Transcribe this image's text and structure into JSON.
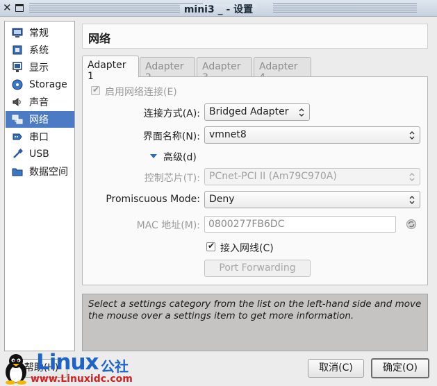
{
  "window": {
    "title": "mini3 _ - 设置"
  },
  "sidebar": {
    "items": [
      {
        "label": "常规"
      },
      {
        "label": "系统"
      },
      {
        "label": "显示"
      },
      {
        "label": "Storage"
      },
      {
        "label": "声音"
      },
      {
        "label": "网络"
      },
      {
        "label": "串口"
      },
      {
        "label": "USB"
      },
      {
        "label": "数据空间"
      }
    ],
    "active_index": 5
  },
  "page": {
    "title": "网络"
  },
  "tabs": [
    {
      "label": "Adapter 1"
    },
    {
      "label": "Adapter 2"
    },
    {
      "label": "Adapter 3"
    },
    {
      "label": "Adapter 4"
    }
  ],
  "form": {
    "enable_label": "启用网络连接(E)",
    "enable_checked": true,
    "attach_label": "连接方式(A):",
    "attach_value": "Bridged Adapter",
    "name_label": "界面名称(N):",
    "name_value": "vmnet8",
    "advanced_label": "高级(d)",
    "chip_label": "控制芯片(T):",
    "chip_value": "PCnet-PCI II (Am79C970A)",
    "promisc_label": "Promiscuous Mode:",
    "promisc_value": "Deny",
    "mac_label": "MAC 地址(M):",
    "mac_value": "0800277FB6DC",
    "cable_label": "接入网线(C)",
    "cable_checked": true,
    "port_forwarding_label": "Port Forwarding"
  },
  "info_text": "Select a settings category from the list on the left-hand side and move the mouse over a settings item to get more information.",
  "footer": {
    "help_label": "帮助(H)",
    "cancel_label": "取消(C)",
    "ok_label": "确定(O)"
  },
  "watermark": {
    "brand": "Linux",
    "suffix": "公社",
    "url": "www.Linuxidc.com"
  },
  "colors": {
    "selection": "#4b7bc4",
    "watermark_blue": "#1e64c8",
    "watermark_red": "#d61f1f"
  }
}
